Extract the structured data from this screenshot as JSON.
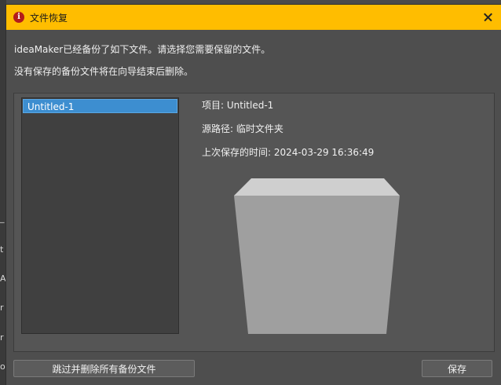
{
  "background_window": {
    "edge_glyphs": [
      "_",
      "t",
      "A",
      "r",
      "r",
      "o"
    ]
  },
  "dialog": {
    "title": "文件恢复",
    "title_icon": "error-info-icon",
    "message_line1": "ideaMaker已经备份了如下文件。请选择您需要保留的文件。",
    "message_line2": "没有保存的备份文件将在向导结束后删除。",
    "file_list": [
      "Untitled-1"
    ],
    "selected_index": 0,
    "details": {
      "project": "项目: Untitled-1",
      "source_path": "源路径: 临时文件夹",
      "last_saved": "上次保存的时间: 2024-03-29 16:36:49"
    },
    "buttons": {
      "skip_delete_all": "跳过并删除所有备份文件",
      "save": "保存"
    }
  },
  "colors": {
    "titlebar": "#ffbd00",
    "selection": "#3d8ed0",
    "dialog_bg": "#4e4e4e"
  }
}
